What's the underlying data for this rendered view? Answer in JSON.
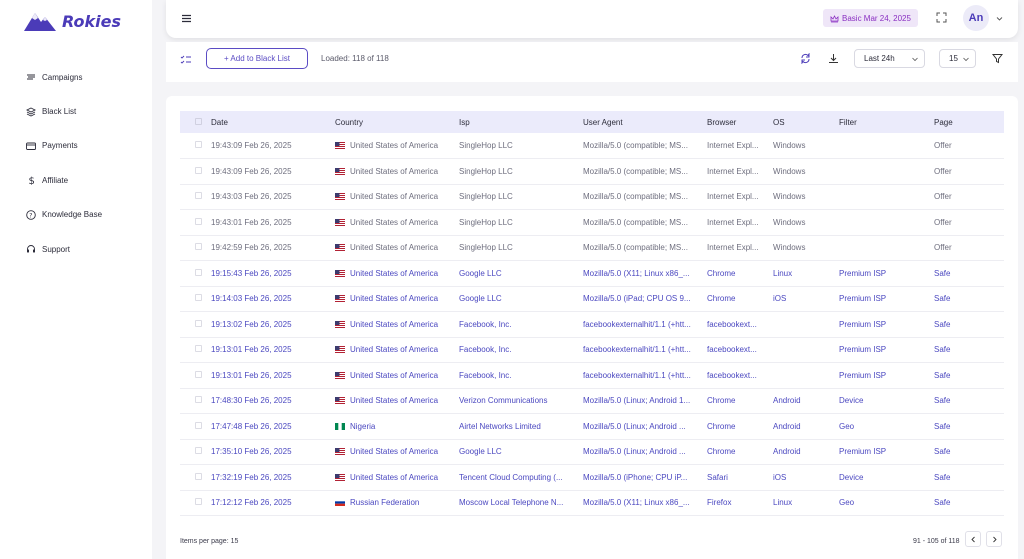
{
  "brand": {
    "name": "Rokies"
  },
  "sidebar": {
    "items": [
      {
        "label": "Campaigns",
        "icon": "campaigns-icon"
      },
      {
        "label": "Black List",
        "icon": "layers-icon"
      },
      {
        "label": "Payments",
        "icon": "card-icon"
      },
      {
        "label": "Affiliate",
        "icon": "dollar-icon"
      },
      {
        "label": "Knowledge Base",
        "icon": "help-icon"
      },
      {
        "label": "Support",
        "icon": "headset-icon"
      }
    ]
  },
  "header": {
    "plan": "Basic Mar 24, 2025",
    "avatar": "An"
  },
  "toolbar": {
    "add_label": "+ Add to Black List",
    "loaded": "Loaded: 118 of 118",
    "period": "Last 24h",
    "page_size": "15"
  },
  "table": {
    "columns": [
      "Date",
      "Country",
      "Isp",
      "User Agent",
      "Browser",
      "OS",
      "Filter",
      "Page"
    ],
    "rows": [
      {
        "date": "19:43:09 Feb 26, 2025",
        "country": "United States of America",
        "flag": "us",
        "isp": "SingleHop LLC",
        "ua": "Mozilla/5.0 (compatible; MS...",
        "browser": "Internet Expl...",
        "os": "Windows",
        "filter": "",
        "page": "Offer",
        "tone": "gray"
      },
      {
        "date": "19:43:09 Feb 26, 2025",
        "country": "United States of America",
        "flag": "us",
        "isp": "SingleHop LLC",
        "ua": "Mozilla/5.0 (compatible; MS...",
        "browser": "Internet Expl...",
        "os": "Windows",
        "filter": "",
        "page": "Offer",
        "tone": "gray"
      },
      {
        "date": "19:43:03 Feb 26, 2025",
        "country": "United States of America",
        "flag": "us",
        "isp": "SingleHop LLC",
        "ua": "Mozilla/5.0 (compatible; MS...",
        "browser": "Internet Expl...",
        "os": "Windows",
        "filter": "",
        "page": "Offer",
        "tone": "gray"
      },
      {
        "date": "19:43:01 Feb 26, 2025",
        "country": "United States of America",
        "flag": "us",
        "isp": "SingleHop LLC",
        "ua": "Mozilla/5.0 (compatible; MS...",
        "browser": "Internet Expl...",
        "os": "Windows",
        "filter": "",
        "page": "Offer",
        "tone": "gray"
      },
      {
        "date": "19:42:59 Feb 26, 2025",
        "country": "United States of America",
        "flag": "us",
        "isp": "SingleHop LLC",
        "ua": "Mozilla/5.0 (compatible; MS...",
        "browser": "Internet Expl...",
        "os": "Windows",
        "filter": "",
        "page": "Offer",
        "tone": "gray"
      },
      {
        "date": "19:15:43 Feb 26, 2025",
        "country": "United States of America",
        "flag": "us",
        "isp": "Google LLC",
        "ua": "Mozilla/5.0 (X11; Linux x86_...",
        "browser": "Chrome",
        "os": "Linux",
        "filter": "Premium ISP",
        "page": "Safe",
        "tone": "blue"
      },
      {
        "date": "19:14:03 Feb 26, 2025",
        "country": "United States of America",
        "flag": "us",
        "isp": "Google LLC",
        "ua": "Mozilla/5.0 (iPad; CPU OS 9...",
        "browser": "Chrome",
        "os": "iOS",
        "filter": "Premium ISP",
        "page": "Safe",
        "tone": "blue"
      },
      {
        "date": "19:13:02 Feb 26, 2025",
        "country": "United States of America",
        "flag": "us",
        "isp": "Facebook, Inc.",
        "ua": "facebookexternalhit/1.1 (+htt...",
        "browser": "facebookext...",
        "os": "",
        "filter": "Premium ISP",
        "page": "Safe",
        "tone": "blue"
      },
      {
        "date": "19:13:01 Feb 26, 2025",
        "country": "United States of America",
        "flag": "us",
        "isp": "Facebook, Inc.",
        "ua": "facebookexternalhit/1.1 (+htt...",
        "browser": "facebookext...",
        "os": "",
        "filter": "Premium ISP",
        "page": "Safe",
        "tone": "blue"
      },
      {
        "date": "19:13:01 Feb 26, 2025",
        "country": "United States of America",
        "flag": "us",
        "isp": "Facebook, Inc.",
        "ua": "facebookexternalhit/1.1 (+htt...",
        "browser": "facebookext...",
        "os": "",
        "filter": "Premium ISP",
        "page": "Safe",
        "tone": "blue"
      },
      {
        "date": "17:48:30 Feb 26, 2025",
        "country": "United States of America",
        "flag": "us",
        "isp": "Verizon Communications",
        "ua": "Mozilla/5.0 (Linux; Android 1...",
        "browser": "Chrome",
        "os": "Android",
        "filter": "Device",
        "page": "Safe",
        "tone": "blue"
      },
      {
        "date": "17:47:48 Feb 26, 2025",
        "country": "Nigeria",
        "flag": "ng",
        "isp": "Airtel Networks Limited",
        "ua": "Mozilla/5.0 (Linux; Android ...",
        "browser": "Chrome",
        "os": "Android",
        "filter": "Geo",
        "page": "Safe",
        "tone": "blue"
      },
      {
        "date": "17:35:10 Feb 26, 2025",
        "country": "United States of America",
        "flag": "us",
        "isp": "Google LLC",
        "ua": "Mozilla/5.0 (Linux; Android ...",
        "browser": "Chrome",
        "os": "Android",
        "filter": "Premium ISP",
        "page": "Safe",
        "tone": "blue"
      },
      {
        "date": "17:32:19 Feb 26, 2025",
        "country": "United States of America",
        "flag": "us",
        "isp": "Tencent Cloud Computing (...",
        "ua": "Mozilla/5.0 (iPhone; CPU iP...",
        "browser": "Safari",
        "os": "iOS",
        "filter": "Device",
        "page": "Safe",
        "tone": "blue"
      },
      {
        "date": "17:12:12 Feb 26, 2025",
        "country": "Russian Federation",
        "flag": "ru",
        "isp": "Moscow Local Telephone N...",
        "ua": "Mozilla/5.0 (X11; Linux x86_...",
        "browser": "Firefox",
        "os": "Linux",
        "filter": "Geo",
        "page": "Safe",
        "tone": "blue"
      }
    ]
  },
  "footer": {
    "items_per_page": "Items per page: 15",
    "range": "91 - 105 of 118"
  },
  "colors": {
    "accent": "#4b3bb8",
    "plan": "#8a2fc2",
    "header_row": "#ebebfb"
  }
}
